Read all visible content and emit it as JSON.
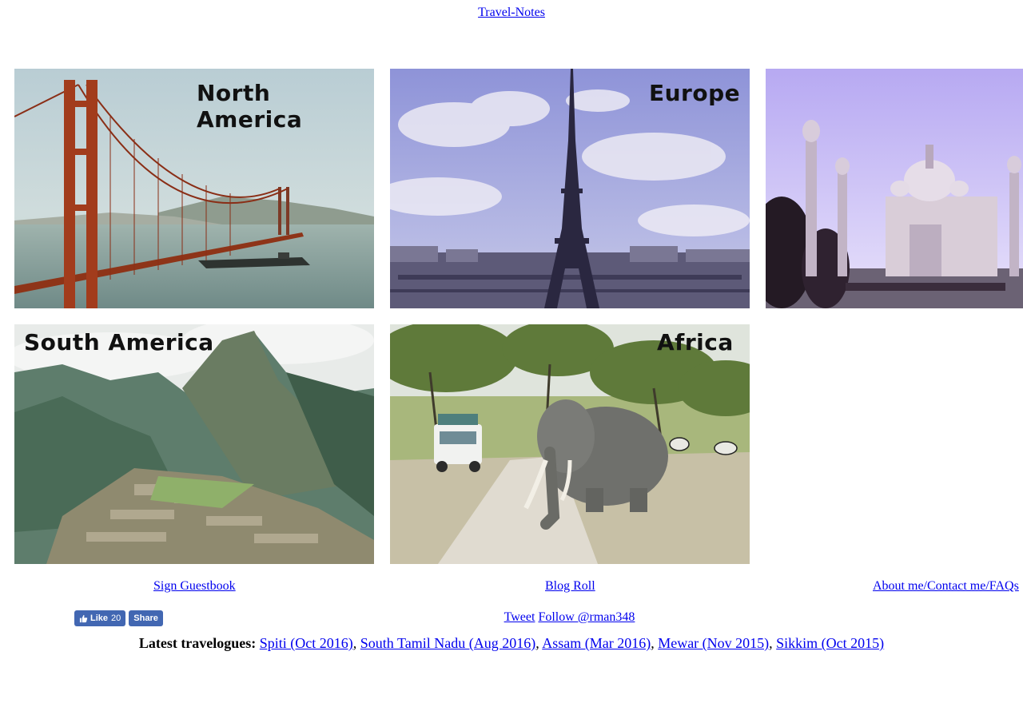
{
  "header": {
    "site_link": "Travel-Notes"
  },
  "tiles": [
    {
      "label": "North America"
    },
    {
      "label": "Europe"
    },
    {
      "label": ""
    },
    {
      "label": "South America"
    },
    {
      "label": "Africa"
    }
  ],
  "footer": {
    "guestbook": "Sign Guestbook",
    "blogroll": "Blog Roll",
    "about": "About me/Contact me/FAQs"
  },
  "facebook": {
    "like_label": "Like",
    "like_count": "20",
    "share_label": "Share",
    "brand_color": "#4267b2"
  },
  "twitter": {
    "tweet_label": "Tweet",
    "follow_label": "Follow @rman348"
  },
  "latest": {
    "heading": "Latest travelogues:",
    "items": [
      "Spiti (Oct 2016)",
      "South Tamil Nadu (Aug 2016)",
      "Assam (Mar 2016)",
      "Mewar (Nov 2015)",
      "Sikkim (Oct 2015)"
    ]
  },
  "colors": {
    "link": "#0000ee",
    "background": "#ffffff"
  }
}
